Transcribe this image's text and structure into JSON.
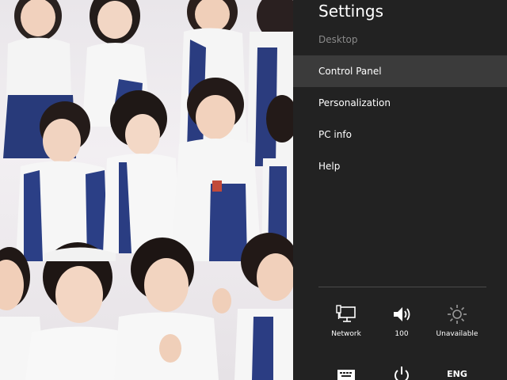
{
  "settings": {
    "title": "Settings",
    "subtitle": "Desktop",
    "menu": [
      {
        "label": "Control Panel",
        "selected": true
      },
      {
        "label": "Personalization",
        "selected": false
      },
      {
        "label": "PC info",
        "selected": false
      },
      {
        "label": "Help",
        "selected": false
      }
    ],
    "tiles": {
      "network": {
        "label": "Network",
        "icon": "network-monitor-icon"
      },
      "volume": {
        "label": "100",
        "icon": "speaker-icon"
      },
      "brightness": {
        "label": "Unavailable",
        "icon": "brightness-sun-icon"
      },
      "keyboard": {
        "icon": "keyboard-icon"
      },
      "power": {
        "icon": "power-icon"
      },
      "language": {
        "label": "ENG"
      }
    }
  },
  "colors": {
    "panel_bg": "#222222",
    "selected_bg": "#3b3b3b",
    "subtitle_text": "#8a8a8a"
  },
  "wallpaper": {
    "description_icon": "photo-wallpaper"
  }
}
